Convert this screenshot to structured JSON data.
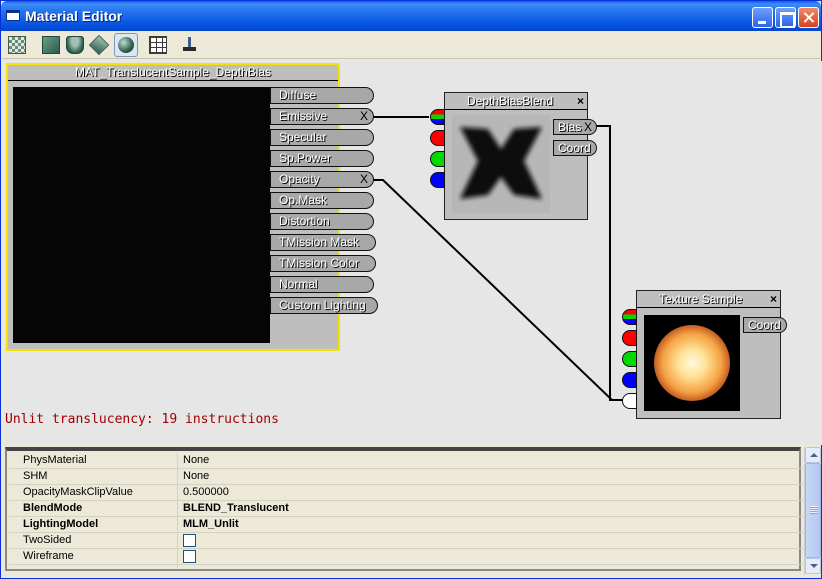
{
  "window": {
    "title": "Material Editor"
  },
  "toolbar": {
    "icons": [
      "checker-icon",
      "plane-icon",
      "cylinder-icon",
      "cube-icon",
      "sphere-icon",
      "grid-icon",
      "stand-icon"
    ]
  },
  "material_node": {
    "title": "MAT_TranslucentSample_DepthBias",
    "inputs": [
      {
        "label": "Diffuse",
        "connected": false
      },
      {
        "label": "Emissive",
        "connected": true
      },
      {
        "label": "Specular",
        "connected": false
      },
      {
        "label": "Sp.Power",
        "connected": false
      },
      {
        "label": "Opacity",
        "connected": true
      },
      {
        "label": "Op.Mask",
        "connected": false
      },
      {
        "label": "Distortion",
        "connected": false
      },
      {
        "label": "TMission Mask",
        "connected": false
      },
      {
        "label": "TMission Color",
        "connected": false
      },
      {
        "label": "Normal",
        "connected": false
      },
      {
        "label": "Custom Lighting",
        "connected": false
      }
    ],
    "disconnect_glyph": "X"
  },
  "depth_bias_node": {
    "title": "DepthBiasBlend",
    "close_glyph": "×",
    "outputs": [
      {
        "label": "Bias"
      },
      {
        "label": "Coord"
      }
    ],
    "input_colors": [
      "#ff0000",
      "#00d800",
      "#0000ff"
    ]
  },
  "texture_node": {
    "title": "Texture Sample",
    "close_glyph": "×",
    "outputs": [
      {
        "label": "Coord"
      }
    ],
    "input_colors": [
      "#ff0000",
      "#00d800",
      "#0000ff",
      "#ffffff"
    ]
  },
  "status": {
    "text": "Unlit translucency: 19 instructions"
  },
  "colors": {
    "node_selected_border": "#F2E300",
    "wire": "#000000",
    "status_text": "#A00000"
  },
  "properties": [
    {
      "name": "PhysMaterial",
      "value": "None",
      "bold": false,
      "type": "text"
    },
    {
      "name": "SHM",
      "value": "None",
      "bold": false,
      "type": "text"
    },
    {
      "name": "OpacityMaskClipValue",
      "value": "0.500000",
      "bold": false,
      "type": "text"
    },
    {
      "name": "BlendMode",
      "value": "BLEND_Translucent",
      "bold": true,
      "type": "text"
    },
    {
      "name": "LightingModel",
      "value": "MLM_Unlit",
      "bold": true,
      "type": "text"
    },
    {
      "name": "TwoSided",
      "value": false,
      "bold": false,
      "type": "checkbox"
    },
    {
      "name": "Wireframe",
      "value": false,
      "bold": false,
      "type": "checkbox"
    }
  ]
}
